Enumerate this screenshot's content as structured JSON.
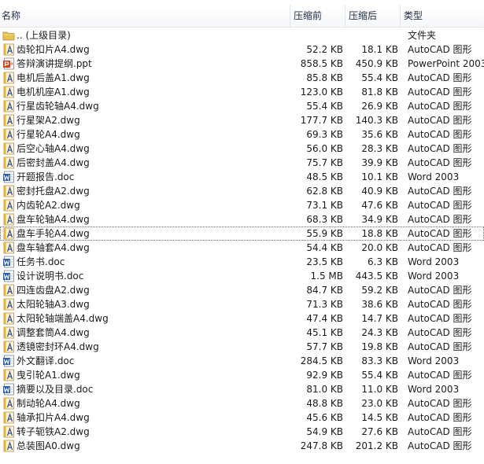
{
  "columns": {
    "name": "名称",
    "before": "压缩前",
    "after": "压缩后",
    "type": "类型"
  },
  "colors": {
    "autocad_icon": "#e9b52e",
    "word_icon": "#2f5ea9",
    "ppt_icon": "#d24726",
    "folder_icon": "#e8c157"
  },
  "files": [
    {
      "icon": "folder-up-icon",
      "name": ".. (上级目录)",
      "before": "",
      "after": "",
      "type": "文件夹"
    },
    {
      "icon": "autocad-file-icon",
      "name": "齿轮扣片A4.dwg",
      "before": "52.2 KB",
      "after": "18.1 KB",
      "type": "AutoCAD 图形"
    },
    {
      "icon": "powerpoint-file-icon",
      "name": "答辩演讲提纲.ppt",
      "before": "858.5 KB",
      "after": "450.9 KB",
      "type": "PowerPoint 2003"
    },
    {
      "icon": "autocad-file-icon",
      "name": "电机后盖A1.dwg",
      "before": "85.8 KB",
      "after": "55.4 KB",
      "type": "AutoCAD 图形"
    },
    {
      "icon": "autocad-file-icon",
      "name": "电机机座A1.dwg",
      "before": "123.0 KB",
      "after": "81.8 KB",
      "type": "AutoCAD 图形"
    },
    {
      "icon": "autocad-file-icon",
      "name": "行星齿轮轴A4.dwg",
      "before": "55.4 KB",
      "after": "26.9 KB",
      "type": "AutoCAD 图形"
    },
    {
      "icon": "autocad-file-icon",
      "name": "行星架A2.dwg",
      "before": "177.7 KB",
      "after": "140.3 KB",
      "type": "AutoCAD 图形"
    },
    {
      "icon": "autocad-file-icon",
      "name": "行星轮A4.dwg",
      "before": "69.3 KB",
      "after": "35.6 KB",
      "type": "AutoCAD 图形"
    },
    {
      "icon": "autocad-file-icon",
      "name": "后空心轴A4.dwg",
      "before": "56.0 KB",
      "after": "28.3 KB",
      "type": "AutoCAD 图形"
    },
    {
      "icon": "autocad-file-icon",
      "name": "后密封盖A4.dwg",
      "before": "75.7 KB",
      "after": "39.9 KB",
      "type": "AutoCAD 图形"
    },
    {
      "icon": "word-file-icon",
      "name": "开题报告.doc",
      "before": "48.5 KB",
      "after": "10.1 KB",
      "type": "Word 2003"
    },
    {
      "icon": "autocad-file-icon",
      "name": "密封托盘A2.dwg",
      "before": "62.8 KB",
      "after": "40.9 KB",
      "type": "AutoCAD 图形"
    },
    {
      "icon": "autocad-file-icon",
      "name": "内齿轮A2.dwg",
      "before": "73.1 KB",
      "after": "47.6 KB",
      "type": "AutoCAD 图形"
    },
    {
      "icon": "autocad-file-icon",
      "name": "盘车轮轴A4.dwg",
      "before": "68.3 KB",
      "after": "34.9 KB",
      "type": "AutoCAD 图形"
    },
    {
      "icon": "autocad-file-icon",
      "name": "盘车手轮A4.dwg",
      "before": "55.9 KB",
      "after": "18.8 KB",
      "type": "AutoCAD 图形",
      "selected": true
    },
    {
      "icon": "autocad-file-icon",
      "name": "盘车轴套A4.dwg",
      "before": "54.4 KB",
      "after": "20.0 KB",
      "type": "AutoCAD 图形"
    },
    {
      "icon": "word-file-icon",
      "name": "任务书.doc",
      "before": "23.5 KB",
      "after": "6.3 KB",
      "type": "Word 2003"
    },
    {
      "icon": "word-file-icon",
      "name": "设计说明书.doc",
      "before": "1.5 MB",
      "after": "443.5 KB",
      "type": "Word 2003"
    },
    {
      "icon": "autocad-file-icon",
      "name": "四连齿盘A2.dwg",
      "before": "84.7 KB",
      "after": "59.2 KB",
      "type": "AutoCAD 图形"
    },
    {
      "icon": "autocad-file-icon",
      "name": "太阳轮轴A3.dwg",
      "before": "71.3 KB",
      "after": "38.6 KB",
      "type": "AutoCAD 图形"
    },
    {
      "icon": "autocad-file-icon",
      "name": "太阳轮轴端盖A4.dwg",
      "before": "47.4 KB",
      "after": "14.7 KB",
      "type": "AutoCAD 图形"
    },
    {
      "icon": "autocad-file-icon",
      "name": "调整套筒A4.dwg",
      "before": "45.1 KB",
      "after": "24.3 KB",
      "type": "AutoCAD 图形"
    },
    {
      "icon": "autocad-file-icon",
      "name": "透镜密封环A4.dwg",
      "before": "57.7 KB",
      "after": "19.8 KB",
      "type": "AutoCAD 图形"
    },
    {
      "icon": "word-file-icon",
      "name": "外文翻译.doc",
      "before": "284.5 KB",
      "after": "83.3 KB",
      "type": "Word 2003"
    },
    {
      "icon": "autocad-file-icon",
      "name": "曳引轮A1.dwg",
      "before": "92.9 KB",
      "after": "55.4 KB",
      "type": "AutoCAD 图形"
    },
    {
      "icon": "word-file-icon",
      "name": "摘要以及目录.doc",
      "before": "81.0 KB",
      "after": "11.0 KB",
      "type": "Word 2003"
    },
    {
      "icon": "autocad-file-icon",
      "name": "制动轮A4.dwg",
      "before": "48.8 KB",
      "after": "23.0 KB",
      "type": "AutoCAD 图形"
    },
    {
      "icon": "autocad-file-icon",
      "name": "轴承扣片A4.dwg",
      "before": "45.6 KB",
      "after": "14.5 KB",
      "type": "AutoCAD 图形"
    },
    {
      "icon": "autocad-file-icon",
      "name": "转子轭铁A2.dwg",
      "before": "54.9 KB",
      "after": "27.6 KB",
      "type": "AutoCAD 图形"
    },
    {
      "icon": "autocad-file-icon",
      "name": "总装图A0.dwg",
      "before": "247.8 KB",
      "after": "201.2 KB",
      "type": "AutoCAD 图形"
    }
  ]
}
